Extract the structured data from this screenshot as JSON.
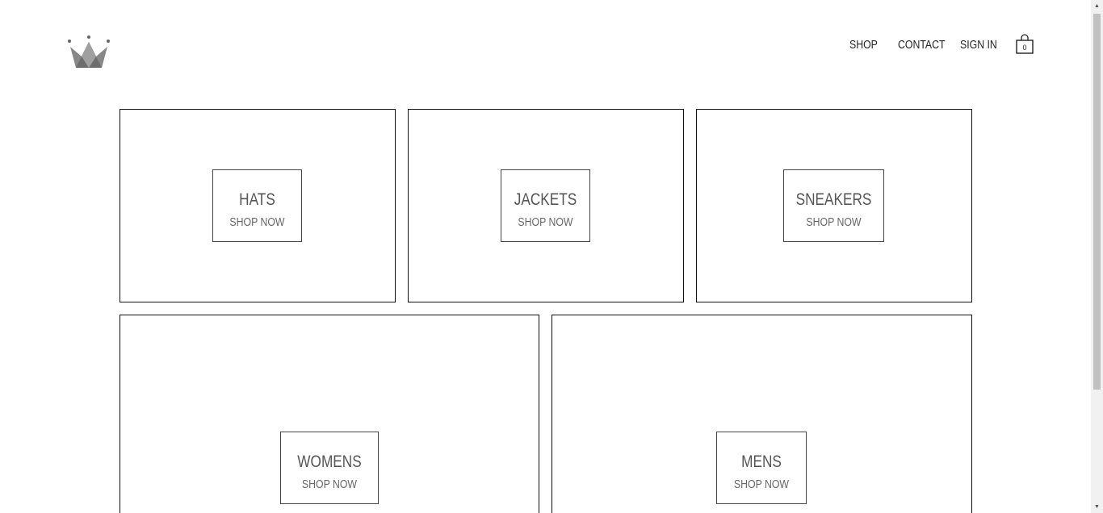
{
  "header": {
    "logo_icon": "crown-icon",
    "nav": {
      "shop": "SHOP",
      "contact": "CONTACT",
      "sign_in": "SIGN IN"
    },
    "cart": {
      "icon": "shopping-bag-icon",
      "count": "0"
    }
  },
  "directory": {
    "cta": "SHOP NOW",
    "categories": [
      {
        "title": "HATS"
      },
      {
        "title": "JACKETS"
      },
      {
        "title": "SNEAKERS"
      },
      {
        "title": "WOMENS"
      },
      {
        "title": "MENS"
      }
    ]
  },
  "colors": {
    "border": "#111111",
    "title_text": "#555555",
    "logo_gray": "#808080"
  }
}
